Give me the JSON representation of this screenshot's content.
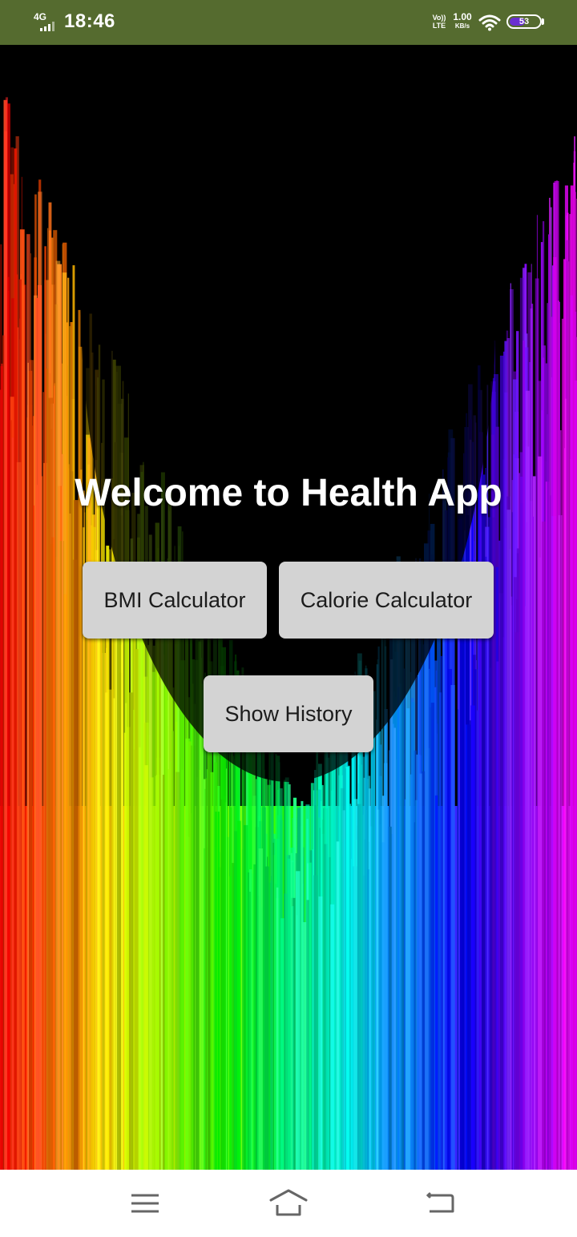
{
  "status_bar": {
    "network": "4G",
    "time": "18:46",
    "volte": "Vo)) LTE",
    "speed_value": "1.00",
    "speed_unit": "KB/s",
    "battery": "53",
    "battery_level_percent": 53,
    "icons": [
      "signal-icon",
      "volte-icon",
      "wifi-icon",
      "battery-icon"
    ]
  },
  "main": {
    "title": "Welcome to Health App",
    "buttons": {
      "bmi": "BMI Calculator",
      "calorie": "Calorie Calculator",
      "history": "Show History"
    }
  },
  "nav_bar": {
    "icons": [
      "menu-icon",
      "home-icon",
      "back-icon"
    ]
  },
  "colors": {
    "status_bar": "#556b2f",
    "button_bg": "#d3d3d3",
    "title_text": "#ffffff",
    "battery_accent": "#6a2fd0"
  }
}
